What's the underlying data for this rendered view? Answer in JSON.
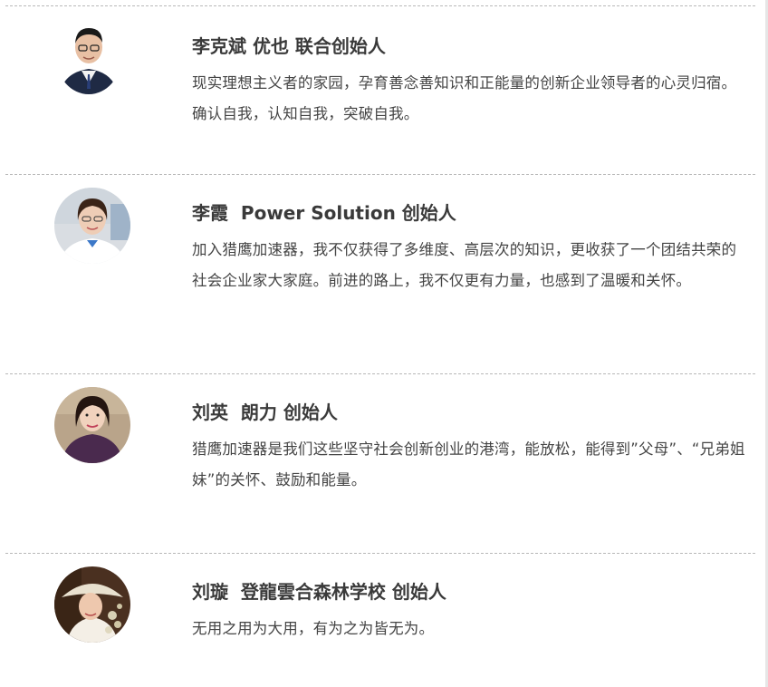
{
  "testimonials": [
    {
      "name": "李克斌",
      "org_role": "优也 联合创始人",
      "title": "李克斌 优也 联合创始人",
      "quote": "现实理想主义者的家园，孕育善念善知识和正能量的创新企业领导者的心灵归宿。确认自我，认知自我，突破自我。"
    },
    {
      "name": "李霞",
      "org_role": "Power Solution 创始人",
      "title": "李霞  Power Solution 创始人",
      "quote": "加入猎鹰加速器，我不仅获得了多维度、高层次的知识，更收获了一个团结共荣的社会企业家大家庭。前进的路上，我不仅更有力量，也感到了温暖和关怀。"
    },
    {
      "name": "刘英",
      "org_role": "朗力 创始人",
      "title": "刘英  朗力 创始人",
      "quote": "猎鹰加速器是我们这些坚守社会创新创业的港湾，能放松，能得到”父母”、“兄弟姐妹”的关怀、鼓励和能量。"
    },
    {
      "name": "刘璇",
      "org_role": "登龍雲合森林学校 创始人",
      "title": "刘璇  登龍雲合森林学校 创始人",
      "quote": "无用之用为大用，有为之为皆无为。"
    }
  ]
}
